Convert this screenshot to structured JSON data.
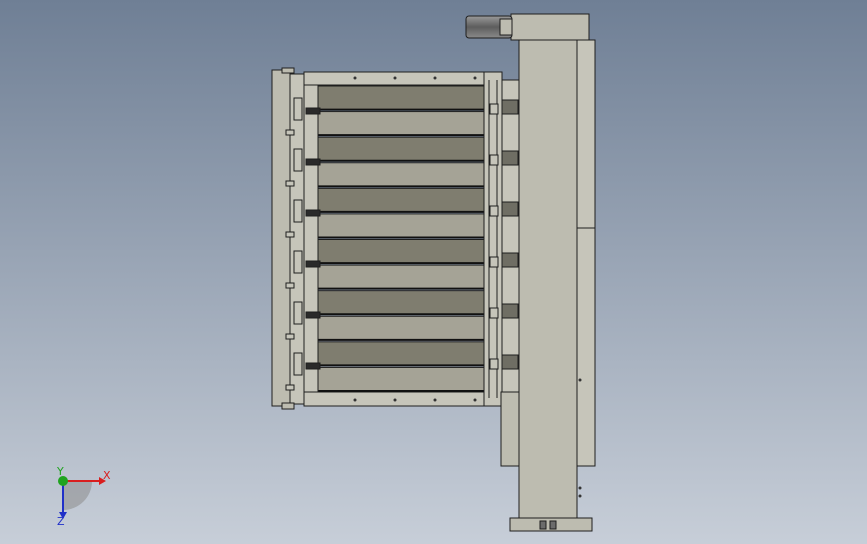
{
  "viewport": {
    "background_top": "#6f7f95",
    "background_bottom": "#c7ced8"
  },
  "model": {
    "fill_body": "#bdbcb0",
    "fill_light": "#c6c5ba",
    "fill_dark_slat": "#7f7d6f",
    "fill_mid_slat": "#a5a396",
    "fill_motor": "#6b6b6b",
    "stroke": "#1e1e1e",
    "slat_count": 12
  },
  "triad": {
    "x_label": "X",
    "y_label": "Y",
    "z_label": "Z",
    "x_color": "#d91e1e",
    "y_color": "#1fa31f",
    "z_color": "#2030c8"
  }
}
